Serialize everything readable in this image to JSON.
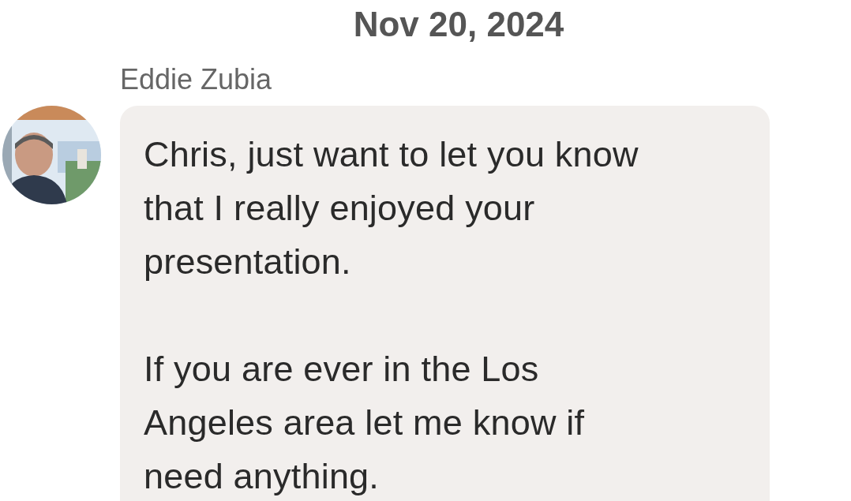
{
  "date": "Nov 20, 2024",
  "message": {
    "sender": "Eddie Zubia",
    "paragraphs": [
      {
        "lines": [
          "Chris, just want to let you know",
          "that I really enjoyed your",
          "presentation."
        ]
      },
      {
        "lines": [
          "If you are ever in the Los",
          "Angeles area let me know if",
          "need anything."
        ]
      }
    ]
  }
}
